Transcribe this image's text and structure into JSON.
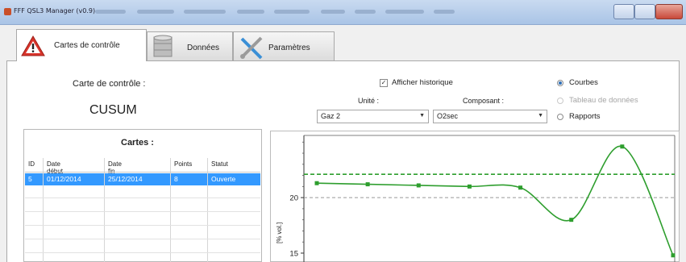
{
  "window": {
    "title": "FFF QSL3 Manager (v0.9)"
  },
  "tabs": [
    {
      "label": "Cartes de contrôle",
      "icon": "warning-icon",
      "active": true
    },
    {
      "label": "Données",
      "icon": "database-icon",
      "active": false
    },
    {
      "label": "Paramètres",
      "icon": "tools-icon",
      "active": false
    }
  ],
  "header": {
    "chart_label": "Carte de contrôle :",
    "chart_type": "CUSUM",
    "show_history_label": "Afficher historique",
    "show_history_checked": true,
    "unit_label": "Unité :",
    "unit_value": "Gaz 2",
    "component_label": "Composant :",
    "component_value": "O2sec"
  },
  "view_options": [
    {
      "label": "Courbes",
      "selected": true,
      "enabled": true
    },
    {
      "label": "Tableau de données",
      "selected": false,
      "enabled": false
    },
    {
      "label": "Rapports",
      "selected": false,
      "enabled": true
    }
  ],
  "cartes": {
    "title": "Cartes :",
    "columns": [
      "ID",
      "Date début",
      "Date fin",
      "Points",
      "Statut"
    ],
    "rows": [
      [
        "5",
        "01/12/2014",
        "25/12/2014",
        "8",
        "Ouverte"
      ]
    ]
  },
  "chart_data": {
    "type": "line",
    "ylabel": "[% vol.]",
    "y_ticks": [
      15,
      20
    ],
    "ylim": [
      14.2,
      25.6
    ],
    "limit_lines": [
      {
        "value": 22.1,
        "style": "dashed",
        "color": "#2e9e2e"
      },
      {
        "value": 20.0,
        "style": "dashed",
        "color": "#999999"
      }
    ],
    "series": [
      {
        "color": "#2e9e2e",
        "points": [
          [
            1,
            21.3
          ],
          [
            2,
            21.2
          ],
          [
            3,
            21.1
          ],
          [
            4,
            21.0
          ],
          [
            5,
            20.9
          ],
          [
            6,
            18.0
          ],
          [
            7,
            24.6
          ],
          [
            8,
            14.8
          ]
        ]
      }
    ]
  },
  "colors": {
    "selection": "#3399ff",
    "series": "#2e9e2e"
  }
}
